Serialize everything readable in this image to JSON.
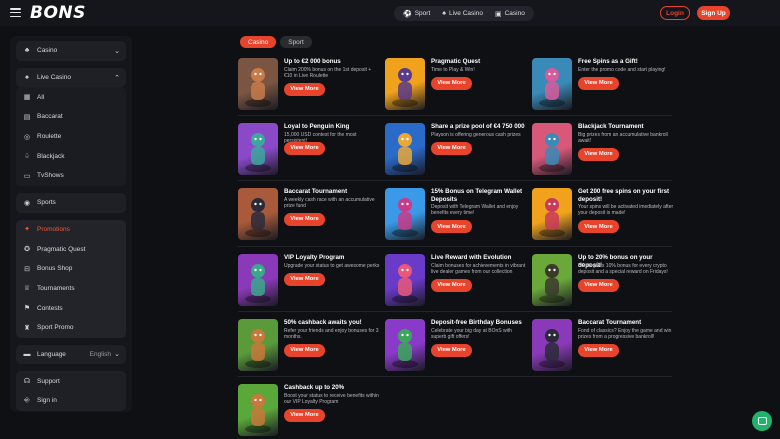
{
  "header": {
    "logo": "BONS",
    "nav": [
      {
        "label": "Sport",
        "icon": "ball-icon"
      },
      {
        "label": "Live Casino",
        "icon": "cards-icon"
      },
      {
        "label": "Casino",
        "icon": "casino-icon"
      }
    ],
    "login": "Login",
    "signup": "Sign Up"
  },
  "sidebar": {
    "casino": "Casino",
    "live_casino": "Live Casino",
    "live_items": [
      "All",
      "Baccarat",
      "Roulette",
      "Blackjack",
      "TvShows"
    ],
    "sports": "Sports",
    "promo_items": [
      "Promotions",
      "Pragmatic Quest",
      "Bonus Shop",
      "Tournaments",
      "Contests",
      "Sport Promo"
    ],
    "language_label": "Language",
    "language_value": "English",
    "support": "Support",
    "signin": "Sign in"
  },
  "tabs": [
    "Casino",
    "Sport"
  ],
  "cta": "View More",
  "colors": {
    "accent": "#e8442c",
    "background": "#0f1014",
    "panel": "#15161b",
    "chat": "#1fb36b"
  },
  "promos": [
    {
      "title": "Up to €2 000 bonus",
      "desc": "Claim 200% bonus on the 1st deposit + €10 in Live Roulette",
      "bg": "#7a5642",
      "char": "#c87a4a"
    },
    {
      "title": "Pragmatic Quest",
      "desc": "Time to Play & Win!",
      "bg": "#f0a21c",
      "char": "#5a3a8a"
    },
    {
      "title": "Free Spins as a Gift!",
      "desc": "Enter the promo code and start playing!",
      "bg": "#3a8ab8",
      "char": "#d85a9a"
    },
    {
      "title": "Loyal to Penguin King",
      "desc": "15,000 USD contest for the most persistent!",
      "bg": "#8a4ac8",
      "char": "#3aa89a"
    },
    {
      "title": "Share a prize pool of €4 750 000",
      "desc": "Playson is offering generous cash prizes",
      "bg": "#2a6ac8",
      "char": "#e8a83a"
    },
    {
      "title": "Blackjack Tournament",
      "desc": "Big prizes from an accumulative bankroll await!",
      "bg": "#d8587a",
      "char": "#3a8ab8"
    },
    {
      "title": "Baccarat Tournament",
      "desc": "A weekly cash race with an accumulative prize fund",
      "bg": "#a85a3a",
      "char": "#2a2a3a"
    },
    {
      "title": "15% Bonus on Telegram Wallet Deposits",
      "desc": "Deposit with Telegram Wallet and enjoy benefits every time!",
      "bg": "#3a9ae8",
      "char": "#c83a8a"
    },
    {
      "title": "Get 200 free spins on your first deposit!",
      "desc": "Your spins will be activated imediately after your deposit is made!",
      "bg": "#f0a21c",
      "char": "#c83a5a"
    },
    {
      "title": "VIP Loyalty Program",
      "desc": "Upgrade your status to get awesome perks",
      "bg": "#8a3ab8",
      "char": "#3aa88a"
    },
    {
      "title": "Live Reward with Evolution",
      "desc": "Claim bonuses for achievements in vibrant live dealer games from our collection",
      "bg": "#6a3ac8",
      "char": "#e8587a"
    },
    {
      "title": "Up to 20% bonus on your deposit!",
      "desc": "BOnS gives 10% bonus for every crypto deposit and a special reward on Fridays!",
      "bg": "#6aa83a",
      "char": "#3a3a2a"
    },
    {
      "title": "50% cashback awaits you!",
      "desc": "Refer your friends and enjoy bonuses for 3 months.",
      "bg": "#5a9a3a",
      "char": "#c8783a"
    },
    {
      "title": "Deposit-free Birthday Bonuses",
      "desc": "Celebrate your big day at BOnS with superb gift offers!",
      "bg": "#8a3ac8",
      "char": "#3aa85a"
    },
    {
      "title": "Baccarat Tournament",
      "desc": "Fond of classics? Enjoy the game and win prizes from a progressive bankroll!",
      "bg": "#8a3ab8",
      "char": "#2a2a3a"
    },
    {
      "title": "Cashback up to 20%",
      "desc": "Boost your status to receive benefits within our VIP Loyalty Program",
      "bg": "#5aa83a",
      "char": "#c8783a"
    }
  ]
}
